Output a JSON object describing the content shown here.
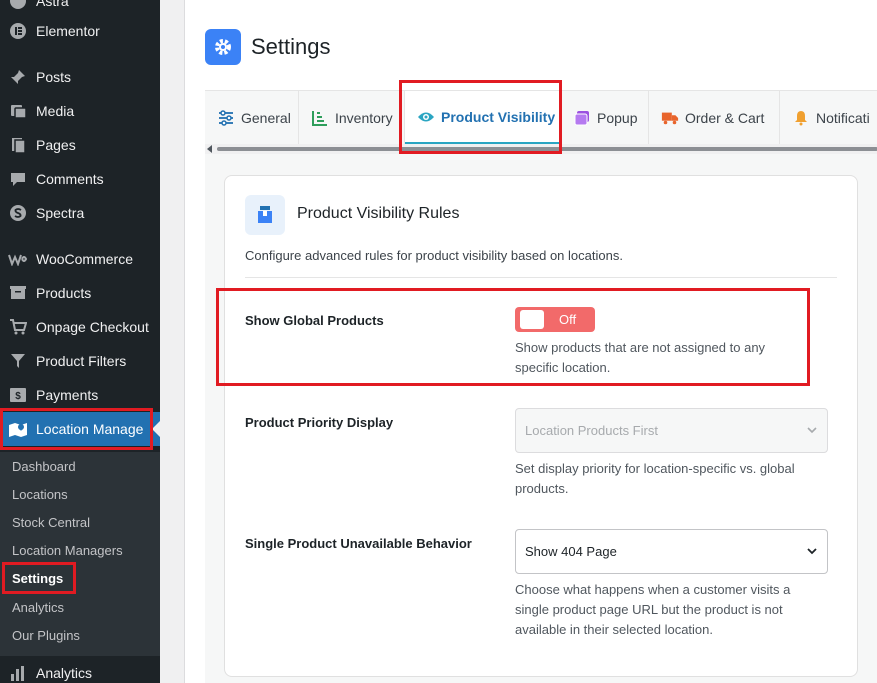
{
  "sidebar": {
    "items": [
      {
        "label": "Astra",
        "icon": "astra-icon"
      },
      {
        "label": "Elementor",
        "icon": "elementor-icon"
      },
      {
        "label": "Posts",
        "icon": "pin-icon"
      },
      {
        "label": "Media",
        "icon": "media-icon"
      },
      {
        "label": "Pages",
        "icon": "pages-icon"
      },
      {
        "label": "Comments",
        "icon": "comment-icon"
      },
      {
        "label": "Spectra",
        "icon": "spectra-icon"
      },
      {
        "label": "WooCommerce",
        "icon": "woocommerce-icon"
      },
      {
        "label": "Products",
        "icon": "products-icon"
      },
      {
        "label": "Onpage Checkout",
        "icon": "cart-icon"
      },
      {
        "label": "Product Filters",
        "icon": "filter-icon"
      },
      {
        "label": "Payments",
        "icon": "payments-icon"
      },
      {
        "label": "Location Manage",
        "icon": "map-icon"
      },
      {
        "label": "Analytics",
        "icon": "analytics-icon"
      }
    ],
    "submenu": [
      "Dashboard",
      "Locations",
      "Stock Central",
      "Location Managers",
      "Settings",
      "Analytics",
      "Our Plugins"
    ]
  },
  "header": {
    "title": "Settings"
  },
  "tabs": [
    {
      "label": "General",
      "icon": "sliders-icon"
    },
    {
      "label": "Inventory",
      "icon": "chart-icon"
    },
    {
      "label": "Product Visibility",
      "icon": "eye-icon"
    },
    {
      "label": "Popup",
      "icon": "popup-icon"
    },
    {
      "label": "Order & Cart",
      "icon": "truck-icon"
    },
    {
      "label": "Notificati",
      "icon": "bell-icon"
    }
  ],
  "card": {
    "title": "Product Visibility Rules",
    "description": "Configure advanced rules for product visibility based on locations.",
    "fields": {
      "global_products": {
        "label": "Show Global Products",
        "toggle_text": "Off",
        "help": "Show products that are not assigned to any specific location."
      },
      "priority_display": {
        "label": "Product Priority Display",
        "value": "Location Products First",
        "help": "Set display priority for location-specific vs. global products."
      },
      "unavailable_behavior": {
        "label": "Single Product Unavailable Behavior",
        "value": "Show 404 Page",
        "help": "Choose what happens when a customer visits a single product page URL but the product is not available in their selected location."
      }
    }
  },
  "colors": {
    "accent": "#2271b1",
    "toggle_off": "#f26a6a",
    "highlight": "#e11b22",
    "sidebar": "#1d2327"
  }
}
